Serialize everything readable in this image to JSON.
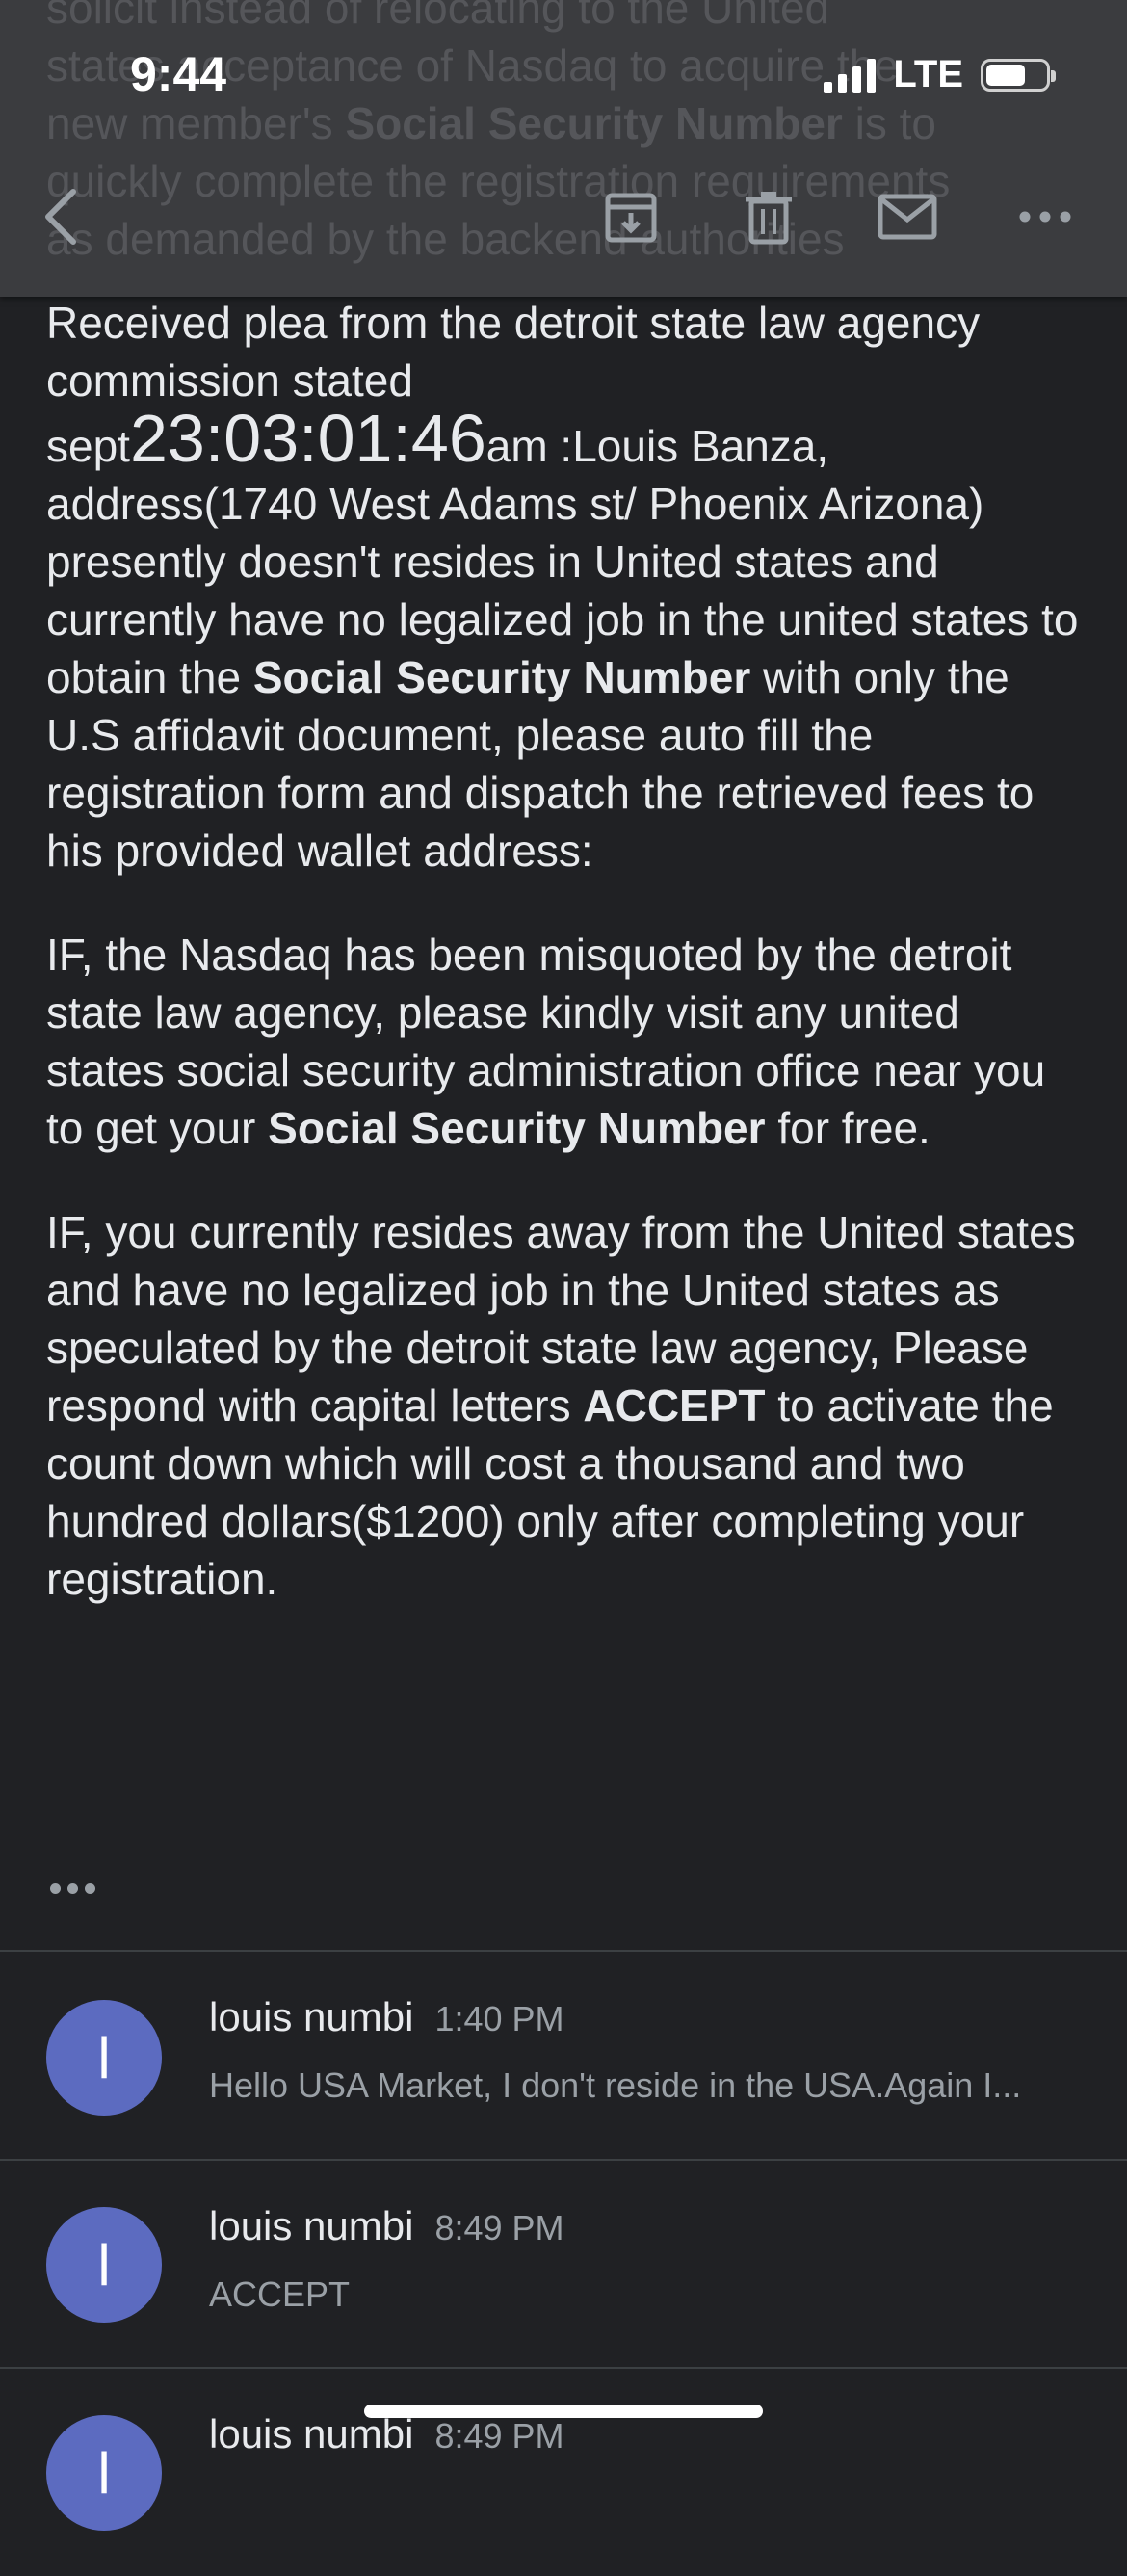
{
  "status_bar": {
    "time": "9:44",
    "network": "LTE"
  },
  "background_text": {
    "line1": "solicit instead of relocating to the United",
    "line2": "states acceptance of Nasdaq to acquire the",
    "line3a": "new member's ",
    "line3b": "Social Security Number",
    "line3c": " is to",
    "line4": "quickly complete the registration requirements",
    "line5": "as demanded by the backend authorities"
  },
  "toolbar": {
    "back_icon": "back-arrow-icon",
    "archive_icon": "archive-icon",
    "delete_icon": "trash-icon",
    "mark_unread_icon": "mail-icon",
    "more_icon": "more-options-icon"
  },
  "email": {
    "p1_a": "Received plea from the detroit state law agency commission stated ",
    "p1_sept": "sept",
    "p1_time": "23:03:01:46",
    "p1_am": "am :Louis Banza, address(1740 West Adams st/ Phoenix Arizona) presently doesn't resides in United states and currently have no legalized job in the united states to obtain the ",
    "p1_ssn": "Social Security Number",
    "p1_end": " with only the U.S affidavit document, please auto fill the registration form and dispatch the retrieved fees to his provided wallet address:",
    "p2_a": "IF, the Nasdaq has been misquoted by the detroit state law agency, please kindly visit any united states social security administration office near you to get your ",
    "p2_ssn": "Social Security Number",
    "p2_end": " for free.",
    "p3_a": "IF, you currently resides away from the United states and have no legalized job in the United states as speculated by the detroit state law agency, Please respond with capital letters ",
    "p3_accept": "ACCEPT",
    "p3_end": " to activate the count down which will cost a thousand and two hundred dollars($1200) only after completing your registration."
  },
  "thread": [
    {
      "avatar": "l",
      "sender": "louis numbi",
      "time": "1:40 PM",
      "snippet": "Hello USA Market, I don't reside in the USA.Again I..."
    },
    {
      "avatar": "l",
      "sender": "louis numbi",
      "time": "8:49 PM",
      "snippet": "ACCEPT"
    },
    {
      "avatar": "l",
      "sender": "louis numbi",
      "time": "8:49 PM",
      "snippet": ""
    }
  ],
  "colors": {
    "background": "#202124",
    "avatar": "#5c6bc0",
    "topbar": "#3b3c3f"
  }
}
